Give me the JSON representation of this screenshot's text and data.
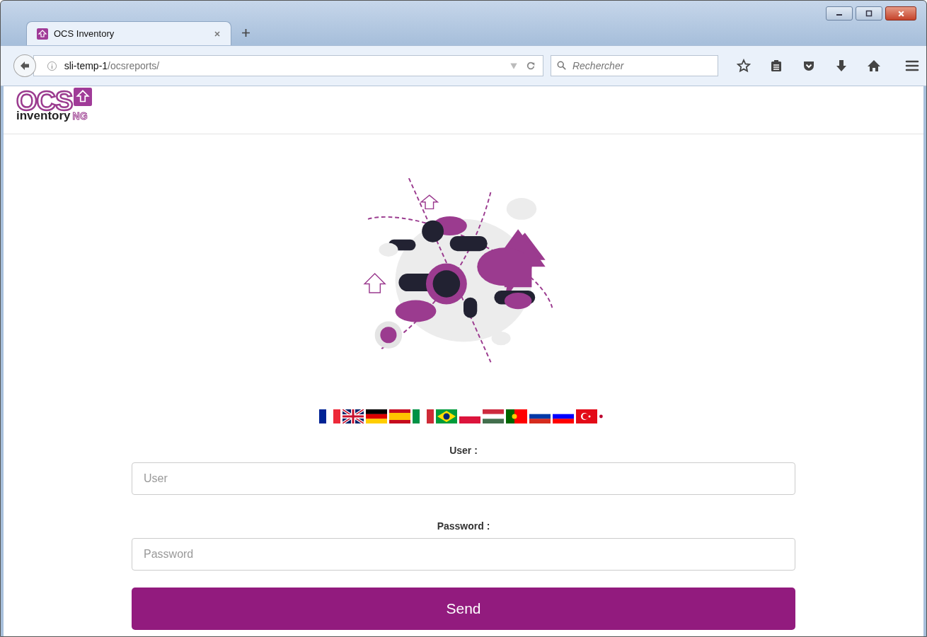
{
  "browser": {
    "tabs": [
      {
        "title": "OCS Inventory",
        "selected": true
      }
    ],
    "url_host": "sli-temp-1",
    "url_path": "/ocsreports/",
    "search": {
      "placeholder": "Rechercher"
    }
  },
  "logo": {
    "primary": "OCS",
    "secondary": "inventory",
    "suffix": "NG"
  },
  "login": {
    "user_label": "User :",
    "user_field": {
      "placeholder": "User"
    },
    "password_label": "Password :",
    "password_field": {
      "placeholder": "Password"
    },
    "submit": "Send"
  }
}
